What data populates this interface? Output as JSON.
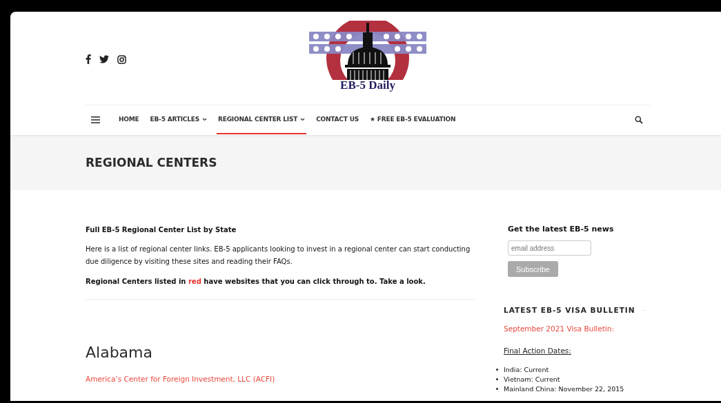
{
  "social": [
    {
      "kind": "facebook"
    },
    {
      "kind": "twitter"
    },
    {
      "kind": "instagram"
    }
  ],
  "logo": {
    "text": "EB-5 Daily"
  },
  "nav": {
    "items": [
      {
        "label": "HOME",
        "dropdown": false,
        "selected": false
      },
      {
        "label": "EB-5 ARTICLES",
        "dropdown": true,
        "selected": false
      },
      {
        "label": "REGIONAL CENTER LIST",
        "dropdown": true,
        "selected": true
      },
      {
        "label": "CONTACT US",
        "dropdown": false,
        "selected": false
      },
      {
        "label": "★ FREE EB-5 EVALUATION",
        "dropdown": false,
        "selected": false
      }
    ]
  },
  "page_title": "REGIONAL CENTERS",
  "main": {
    "heading": "Full EB-5 Regional Center List by State",
    "intro": "Here is a list of regional center links. EB-5 applicants looking to invest in a regional center can start conducting due diligence by visiting these sites and reading their FAQs.",
    "notice": [
      {
        "text": "Regional Centers listed in ",
        "red": false
      },
      {
        "text": "red",
        "red": true
      },
      {
        "text": " have websites that you can click through to. Take a look.",
        "red": false
      }
    ],
    "state": "Alabama",
    "centers": [
      "America’s Center for Foreign Investment, LLC (ACFI)"
    ]
  },
  "sidebar": {
    "news_title": "Get the latest EB-5 news",
    "email": {
      "placeholder": "email address"
    },
    "subscribe": "Subscribe",
    "bulletin_title": "LATEST EB-5 VISA BULLETIN",
    "bulletin_link": "September 2021 Visa Bulletin:",
    "dates_title": "Final Action Dates:",
    "dates": [
      "India: Current",
      "Vietnam: Current",
      "Mainland China: November 22, 2015"
    ]
  }
}
